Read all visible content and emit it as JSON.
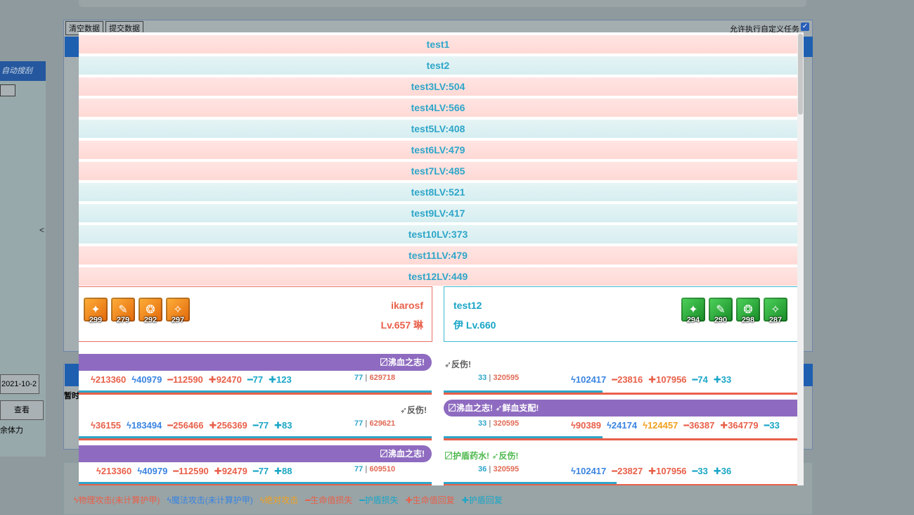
{
  "background": {
    "buttons": [
      "清空数据",
      "提交数据"
    ],
    "checkbox_label": "允许执行自定义任务",
    "checkbox_checked": true,
    "left_header": "自动搜刮",
    "left_chevron": "<",
    "date_value": "2021-10-2",
    "view_button": "查看",
    "rest_label": "余体力",
    "mid_label": "暂时",
    "legend": [
      {
        "icon": "ϟ",
        "text": "物理攻击(未计算护甲)",
        "color": "#e8604a"
      },
      {
        "icon": "ϟ",
        "text": "魔法攻击(未计算护甲)",
        "color": "#3a84e0"
      },
      {
        "icon": "ϟ",
        "text": "绝对攻击",
        "color": "#f0a020"
      },
      {
        "icon": "━",
        "text": "生命值损失",
        "color": "#e8604a"
      },
      {
        "icon": "━",
        "text": "护盾损失",
        "color": "#1aa6c7"
      },
      {
        "icon": "✚",
        "text": "生命值回复",
        "color": "#e8604a"
      },
      {
        "icon": "✚",
        "text": "护盾回复",
        "color": "#1aa6c7"
      }
    ]
  },
  "user_list": [
    {
      "label": "test1",
      "style": "pink"
    },
    {
      "label": "test2",
      "style": "blue"
    },
    {
      "label": "test3LV:504",
      "style": "pink"
    },
    {
      "label": "test4LV:566",
      "style": "pink"
    },
    {
      "label": "test5LV:408",
      "style": "blue"
    },
    {
      "label": "test6LV:479",
      "style": "pink"
    },
    {
      "label": "test7LV:485",
      "style": "pink"
    },
    {
      "label": "test8LV:521",
      "style": "blue"
    },
    {
      "label": "test9LV:417",
      "style": "blue"
    },
    {
      "label": "test10LV:373",
      "style": "blue"
    },
    {
      "label": "test11LV:479",
      "style": "pink"
    },
    {
      "label": "test12LV:449",
      "style": "pink"
    }
  ],
  "players": {
    "left": {
      "name": "ikarosf",
      "level": "Lv.657 琳",
      "skills": [
        "299",
        "279",
        "292",
        "297"
      ],
      "skill_color": "orange"
    },
    "right": {
      "name": "test12",
      "level": "伊 Lv.660",
      "skills": [
        "294",
        "290",
        "298",
        "287"
      ],
      "skill_color": "green"
    }
  },
  "rounds": [
    {
      "left_banner": "〼沸血之志!",
      "left_tag": "",
      "left_stats": [
        {
          "t": "ϟ213360",
          "c": "red"
        },
        {
          "t": "ϟ40979",
          "c": "blue"
        },
        {
          "t": "━112590",
          "c": "red"
        },
        {
          "t": "✚92470",
          "c": "red"
        },
        {
          "t": "━77",
          "c": "teal"
        },
        {
          "t": "✚123",
          "c": "teal"
        }
      ],
      "left_hp": {
        "a": "77",
        "b": "629718"
      },
      "right_banner": "",
      "right_tag": "➶反伤!",
      "right_hp": {
        "a": "33",
        "b": "320595"
      },
      "right_stats": [
        {
          "t": "ϟ102417",
          "c": "blue"
        },
        {
          "t": "━23816",
          "c": "red"
        },
        {
          "t": "✚107956",
          "c": "red"
        },
        {
          "t": "━74",
          "c": "teal"
        },
        {
          "t": "✚33",
          "c": "teal"
        }
      ]
    },
    {
      "left_banner": "",
      "left_tag": "➶反伤!",
      "left_stats": [
        {
          "t": "ϟ36155",
          "c": "red"
        },
        {
          "t": "ϟ183494",
          "c": "blue"
        },
        {
          "t": "━256466",
          "c": "red"
        },
        {
          "t": "✚256369",
          "c": "red"
        },
        {
          "t": "━77",
          "c": "teal"
        },
        {
          "t": "✚83",
          "c": "teal"
        }
      ],
      "left_hp": {
        "a": "77",
        "b": "629621"
      },
      "right_banner": "〼沸血之志! ➶鲜血支配!",
      "right_tag": "",
      "right_hp": {
        "a": "33",
        "b": "320595"
      },
      "right_stats": [
        {
          "t": "ϟ90389",
          "c": "red"
        },
        {
          "t": "ϟ24174",
          "c": "blue"
        },
        {
          "t": "ϟ124457",
          "c": "orange"
        },
        {
          "t": "━36387",
          "c": "red"
        },
        {
          "t": "✚364779",
          "c": "red"
        },
        {
          "t": "━33",
          "c": "teal"
        }
      ]
    },
    {
      "left_banner": "〼沸血之志!",
      "left_tag": "",
      "left_stats": [
        {
          "t": "ϟ213360",
          "c": "red"
        },
        {
          "t": "ϟ40979",
          "c": "blue"
        },
        {
          "t": "━112590",
          "c": "red"
        },
        {
          "t": "✚92479",
          "c": "red"
        },
        {
          "t": "━77",
          "c": "teal"
        },
        {
          "t": "✚88",
          "c": "teal"
        }
      ],
      "left_hp": {
        "a": "77",
        "b": "609510"
      },
      "right_banner": "",
      "right_tag": "〼护盾药水! ➶反伤!",
      "right_hp": {
        "a": "36",
        "b": "320595"
      },
      "right_stats": [
        {
          "t": "ϟ102417",
          "c": "blue"
        },
        {
          "t": "━23827",
          "c": "red"
        },
        {
          "t": "✚107956",
          "c": "red"
        },
        {
          "t": "━33",
          "c": "teal"
        },
        {
          "t": "✚36",
          "c": "teal"
        }
      ]
    }
  ]
}
